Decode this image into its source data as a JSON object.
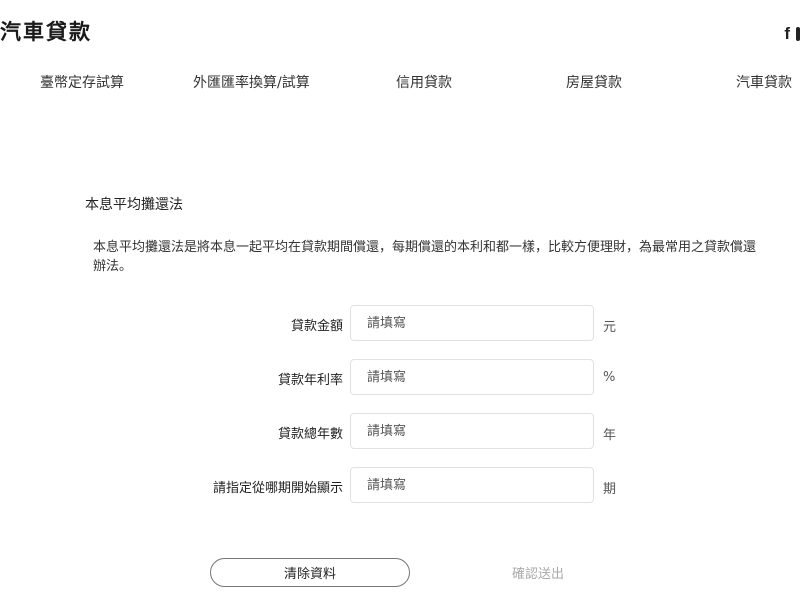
{
  "header": {
    "title": "汽車貸款",
    "facebook_glyph": "f",
    "icons": [
      "facebook-icon",
      "line-icon"
    ]
  },
  "nav": {
    "items": [
      {
        "label": "臺幣定存試算"
      },
      {
        "label": "外匯匯率換算/試算"
      },
      {
        "label": "信用貸款"
      },
      {
        "label": "房屋貸款"
      },
      {
        "label": "汽車貸款"
      }
    ]
  },
  "section": {
    "title": "本息平均攤還法",
    "description": "本息平均攤還法是將本息一起平均在貸款期間償還，每期償還的本利和都一樣，比較方便理財，為最常用之貸款償還辦法。"
  },
  "form": {
    "fields": [
      {
        "label": "貸款金額",
        "placeholder": "請填寫",
        "value": "",
        "unit": "元"
      },
      {
        "label": "貸款年利率",
        "placeholder": "請填寫",
        "value": "",
        "unit": "%"
      },
      {
        "label": "貸款總年數",
        "placeholder": "請填寫",
        "value": "",
        "unit": "年"
      },
      {
        "label": "請指定從哪期開始顯示",
        "placeholder": "請填寫",
        "value": "",
        "unit": "期"
      }
    ]
  },
  "actions": {
    "clear_label": "清除資料",
    "submit_label": "確認送出",
    "submit_color": "#aaaaaa"
  }
}
